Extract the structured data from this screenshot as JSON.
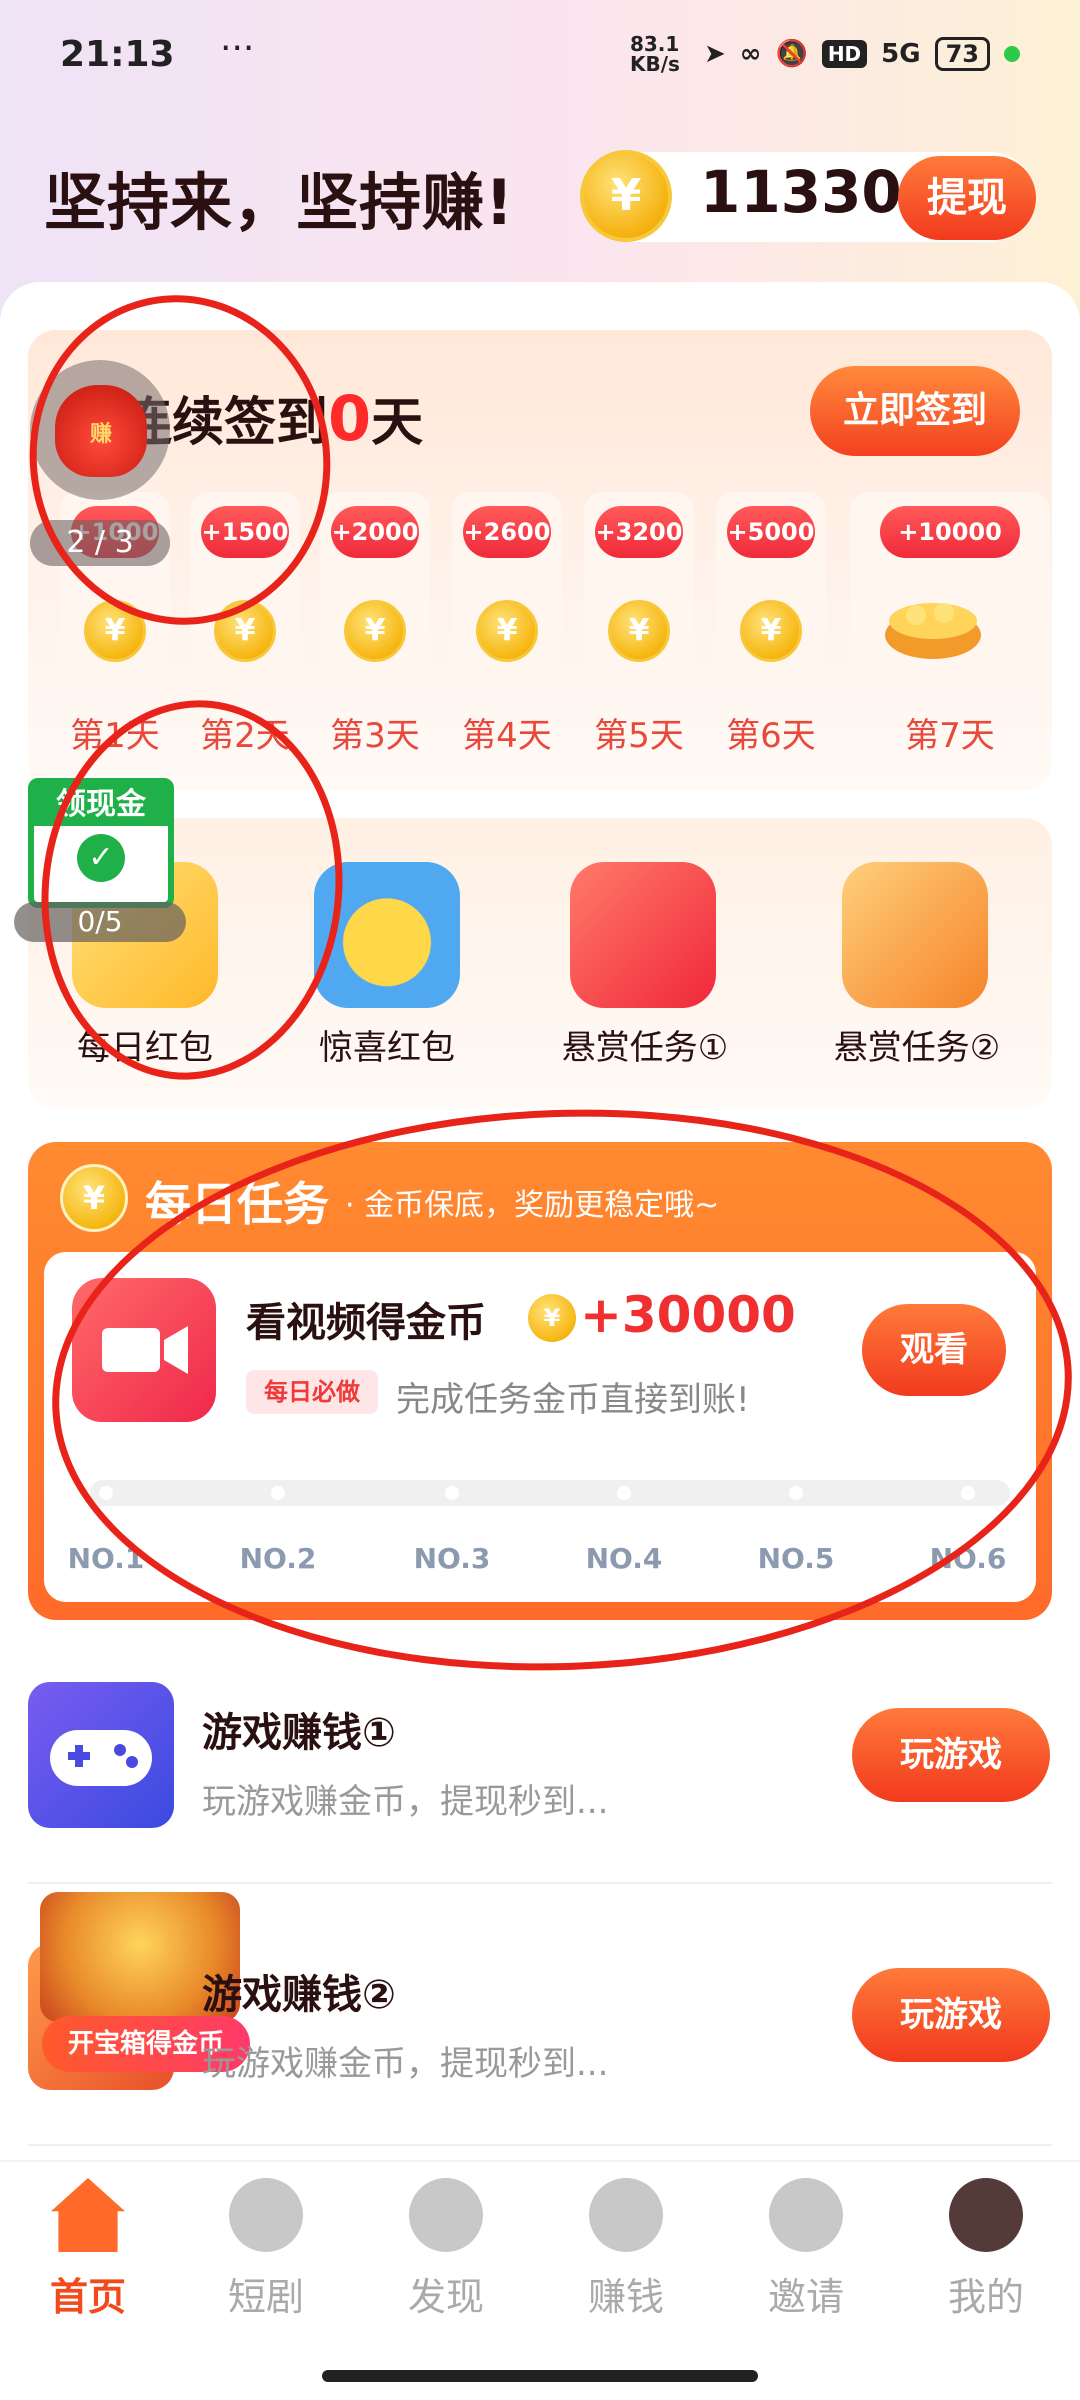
{
  "status": {
    "time": "21:13",
    "dots": "···",
    "network_speed": "83.1 KB/s",
    "signal": "5G",
    "battery": "73"
  },
  "header": {
    "slogan": "坚持来，坚持赚!",
    "coin_amount": "11330",
    "withdraw_label": "提现"
  },
  "signin": {
    "title_prefix": "连续签到",
    "streak": "0",
    "title_suffix": "天",
    "button_label": "立即签到",
    "float_bag_label": "赚",
    "float_progress": "2 / 3",
    "days": [
      {
        "reward": "+1000",
        "label": "第1天"
      },
      {
        "reward": "+1500",
        "label": "第2天"
      },
      {
        "reward": "+2000",
        "label": "第3天"
      },
      {
        "reward": "+2600",
        "label": "第4天"
      },
      {
        "reward": "+3200",
        "label": "第5天"
      },
      {
        "reward": "+5000",
        "label": "第6天"
      },
      {
        "reward": "+10000",
        "label": "第7天"
      }
    ]
  },
  "features": {
    "float_cash_title": "领现金",
    "float_cash_progress": "0/5",
    "items": [
      {
        "label": "每日红包"
      },
      {
        "label": "惊喜红包"
      },
      {
        "label": "悬赏任务①"
      },
      {
        "label": "悬赏任务②"
      }
    ]
  },
  "daily_tasks": {
    "title": "每日任务",
    "subtitle": "· 金币保底，奖励更稳定哦~",
    "task_title": "看视频得金币",
    "task_reward": "+30000",
    "tag": "每日必做",
    "description": "完成任务金币直接到账!",
    "watch_label": "观看",
    "progress_steps": [
      "NO.1",
      "NO.2",
      "NO.3",
      "NO.4",
      "NO.5",
      "NO.6"
    ]
  },
  "games": [
    {
      "title": "游戏赚钱①",
      "desc": "玩游戏赚金币，提现秒到...",
      "button": "玩游戏"
    },
    {
      "title": "游戏赚钱②",
      "desc": "玩游戏赚金币，提现秒到...",
      "button": "玩游戏"
    }
  ],
  "treasure_label": "开宝箱得金币",
  "coin_symbol": "¥",
  "tabs": [
    {
      "label": "首页",
      "icon": "home-icon"
    },
    {
      "label": "短剧",
      "icon": "drama-icon"
    },
    {
      "label": "发现",
      "icon": "compass-icon"
    },
    {
      "label": "赚钱",
      "icon": "money-bag-icon"
    },
    {
      "label": "邀请",
      "icon": "invite-user-icon"
    },
    {
      "label": "我的",
      "icon": "avatar"
    }
  ],
  "colors": {
    "accent": "#f24a1c",
    "reward_red": "#f03030",
    "annotation_red": "#e8231a"
  }
}
